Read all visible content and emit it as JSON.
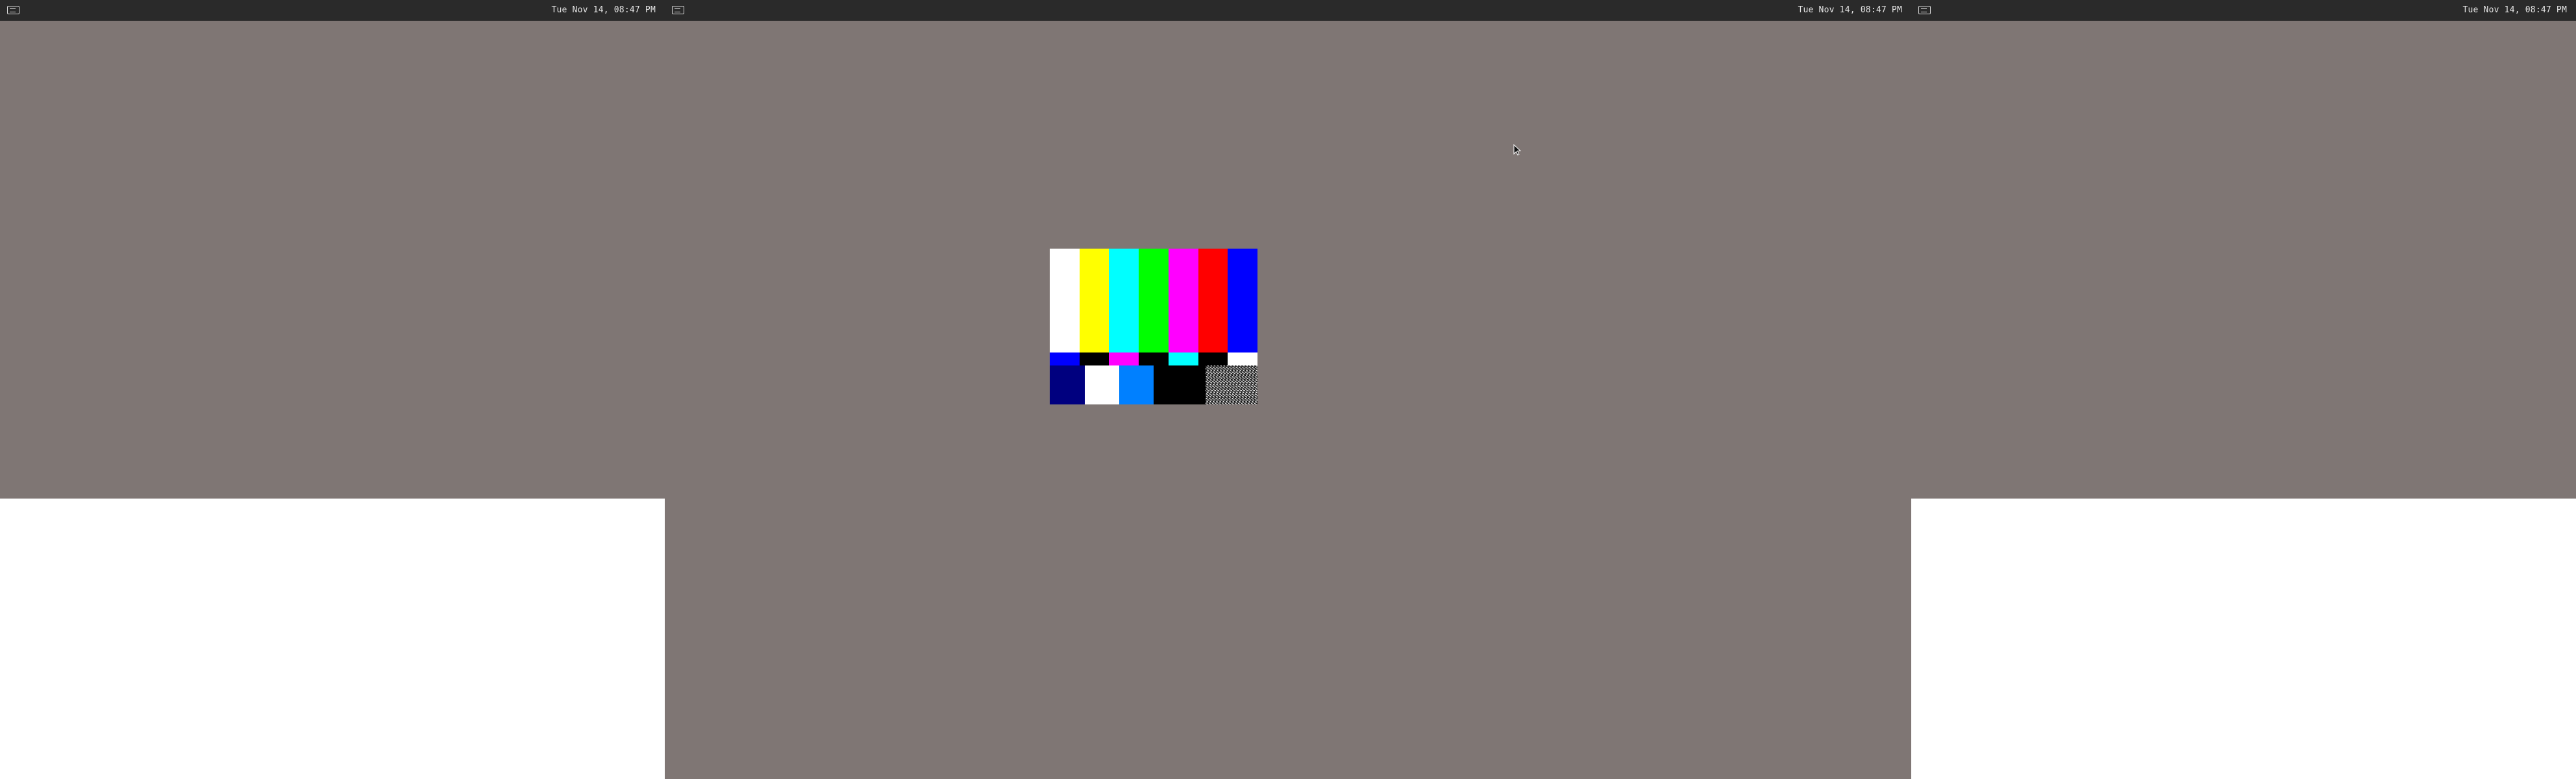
{
  "screens": [
    {
      "id": "left",
      "topbar": {
        "clock": "Tue Nov 14, 08:47 PM"
      }
    },
    {
      "id": "center",
      "topbar": {
        "clock": "Tue Nov 14, 08:47 PM"
      }
    },
    {
      "id": "right",
      "topbar": {
        "clock": "Tue Nov 14, 08:47 PM"
      }
    }
  ],
  "desktop": {
    "background_color": "#7f7674",
    "topbar_color": "#2a2a2a",
    "icons": [
      "activities-icon",
      "mouse-pointer-icon"
    ]
  },
  "test_pattern": {
    "top_bars": [
      "#ffffff",
      "#ffff00",
      "#00ffff",
      "#00ff00",
      "#ff00ff",
      "#ff0000",
      "#0000ff"
    ],
    "middle_bars": [
      "#0000ff",
      "#000000",
      "#ff00ff",
      "#000000",
      "#00ffff",
      "#000000",
      "#ffffff"
    ],
    "bottom_blocks": [
      "#00007f",
      "#ffffff",
      "#0080ff",
      "#000000"
    ]
  }
}
